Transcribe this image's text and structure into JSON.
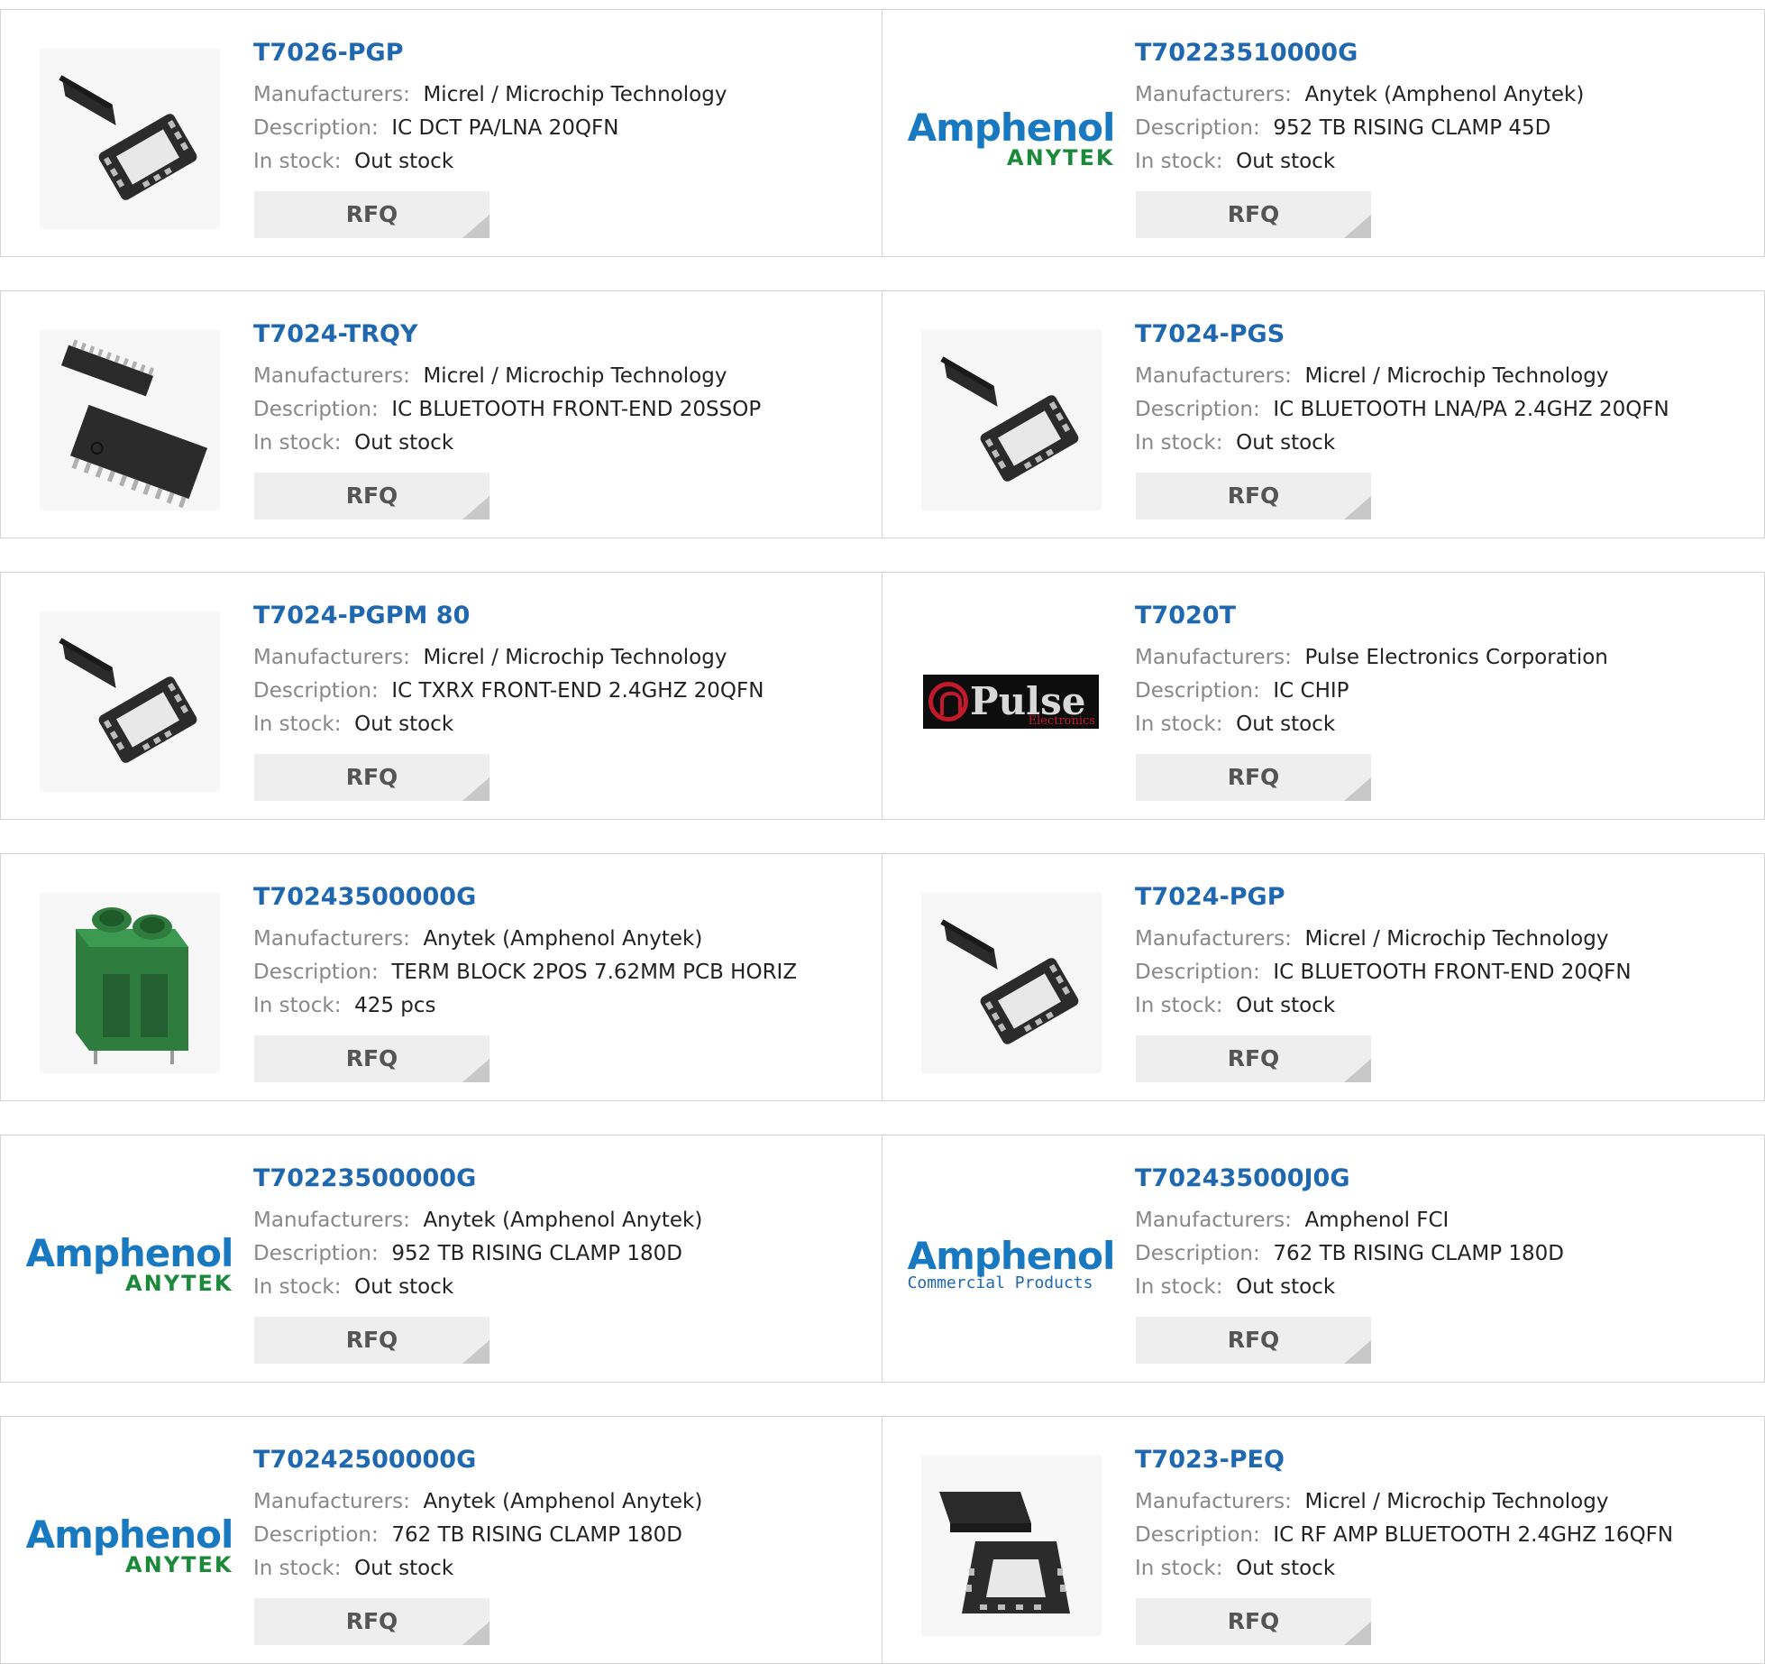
{
  "labels": {
    "manufacturers": "Manufacturers:",
    "description": "Description:",
    "in_stock": "In stock:",
    "rfq": "RFQ"
  },
  "products": [
    {
      "part": "T7026-PGP",
      "manufacturer": "Micrel / Microchip Technology",
      "description": "IC DCT PA/LNA 20QFN",
      "stock": "Out stock",
      "image": "qfn-chip-image"
    },
    {
      "part": "T70223510000G",
      "manufacturer": "Anytek (Amphenol Anytek)",
      "description": "952 TB RISING CLAMP 45D",
      "stock": "Out stock",
      "image": "amphenol-anytek-logo",
      "logo_text": {
        "main": "Amphenol",
        "sub": "ANYTEK"
      }
    },
    {
      "part": "T7024-TRQY",
      "manufacturer": "Micrel / Microchip Technology",
      "description": "IC BLUETOOTH FRONT-END 20SSOP",
      "stock": "Out stock",
      "image": "ssop-chip-image"
    },
    {
      "part": "T7024-PGS",
      "manufacturer": "Micrel / Microchip Technology",
      "description": "IC BLUETOOTH LNA/PA 2.4GHZ 20QFN",
      "stock": "Out stock",
      "image": "qfn-chip-image"
    },
    {
      "part": "T7024-PGPM 80",
      "manufacturer": "Micrel / Microchip Technology",
      "description": "IC TXRX FRONT-END 2.4GHZ 20QFN",
      "stock": "Out stock",
      "image": "qfn-chip-image"
    },
    {
      "part": "T7020T",
      "manufacturer": "Pulse Electronics Corporation",
      "description": "IC CHIP",
      "stock": "Out stock",
      "image": "pulse-electronics-logo",
      "logo_text": {
        "main": "Pulse",
        "sub": "Electronics"
      }
    },
    {
      "part": "T70243500000G",
      "manufacturer": "Anytek (Amphenol Anytek)",
      "description": "TERM BLOCK 2POS 7.62MM PCB HORIZ",
      "stock": "425 pcs",
      "image": "terminal-block-image"
    },
    {
      "part": "T7024-PGP",
      "manufacturer": "Micrel / Microchip Technology",
      "description": "IC BLUETOOTH FRONT-END 20QFN",
      "stock": "Out stock",
      "image": "qfn-chip-image"
    },
    {
      "part": "T70223500000G",
      "manufacturer": "Anytek (Amphenol Anytek)",
      "description": "952 TB RISING CLAMP 180D",
      "stock": "Out stock",
      "image": "amphenol-anytek-logo",
      "logo_text": {
        "main": "Amphenol",
        "sub": "ANYTEK"
      }
    },
    {
      "part": "T702435000J0G",
      "manufacturer": "Amphenol FCI",
      "description": "762 TB RISING CLAMP 180D",
      "stock": "Out stock",
      "image": "amphenol-commercial-logo",
      "logo_text": {
        "main": "Amphenol",
        "sub": "Commercial Products"
      }
    },
    {
      "part": "T70242500000G",
      "manufacturer": "Anytek (Amphenol Anytek)",
      "description": "762 TB RISING CLAMP 180D",
      "stock": "Out stock",
      "image": "amphenol-anytek-logo",
      "logo_text": {
        "main": "Amphenol",
        "sub": "ANYTEK"
      }
    },
    {
      "part": "T7023-PEQ",
      "manufacturer": "Micrel / Microchip Technology",
      "description": "IC RF AMP BLUETOOTH 2.4GHZ 16QFN",
      "stock": "Out stock",
      "image": "qfn16-chip-image"
    }
  ],
  "colors": {
    "part_link": "#1f68b0",
    "label": "#888888",
    "value": "#222222",
    "button_bg": "#eeeeee",
    "border": "#d4d4d4"
  }
}
